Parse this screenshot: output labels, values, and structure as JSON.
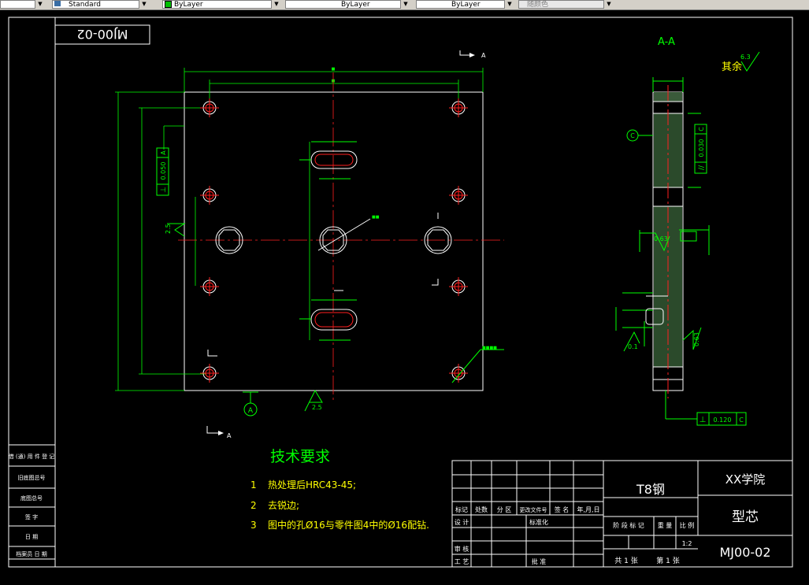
{
  "toolbar": {
    "text_style": "Standard",
    "layer_color": "ByLayer",
    "linetype": "ByLayer",
    "lineweight": "ByLayer",
    "plot_style": "随颜色"
  },
  "drawing": {
    "code_box": "MJ00-02",
    "section_title": "A-A",
    "section_mark_label": "A",
    "roughness_rest_label": "其余",
    "roughness_rest_value": "6.3",
    "roughness_values": [
      "0.63",
      "0.1",
      "0.63",
      "2.5",
      "2.5"
    ],
    "datum_label": "C",
    "datum_a_label": "A",
    "tolerance_perp_left": "0.050",
    "tolerance_perp_left_datum": "A",
    "tolerance_parallel": "0.030",
    "tolerance_parallel_datum": "C",
    "tolerance_perp_bottom": "0.120",
    "tolerance_perp_bottom_datum": "C",
    "tech_title": "技术要求",
    "tech_items": [
      {
        "num": "1",
        "text": "热处理后HRC43-45;"
      },
      {
        "num": "2",
        "text": "去锐边;"
      },
      {
        "num": "3",
        "text": "图中的孔Ø16与零件图4中的Ø16配钻."
      }
    ]
  },
  "title_block": {
    "material": "T8钢",
    "school": "XX学院",
    "part_name": "型芯",
    "drawing_no": "MJ00-02",
    "scale": "1:2",
    "header_cells": [
      "标记",
      "处数",
      "分 区",
      "更改文件号",
      "签 名",
      "年,月,日"
    ],
    "row_design": "设 计",
    "row_standard": "标准化",
    "row_review": "审 核",
    "row_process": "工 艺",
    "row_approve": "批 准",
    "stage_label": "阶 段 标 记",
    "weight_label": "重 量",
    "scale_label": "比 例",
    "sheets_total": "共 1 张",
    "sheet_current": "第 1 张"
  },
  "left_strip": {
    "items": [
      "借 (通) 用 件 登 记",
      "旧底图总号",
      "底图总号",
      "签 字",
      "日 期",
      "档案员 日 期"
    ]
  }
}
